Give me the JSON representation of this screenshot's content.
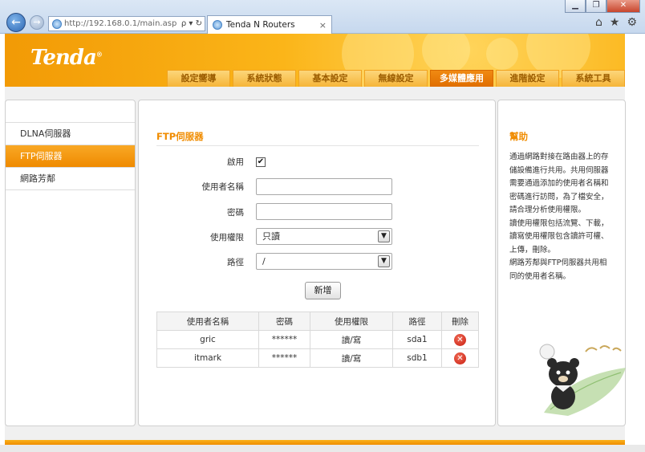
{
  "browser": {
    "url": "http://192.168.0.1/main.asp",
    "address_tools": "ρ ▾ ↻",
    "tab_title": "Tenda N Routers",
    "tab_close": "×",
    "back": "←",
    "forward": "→",
    "window_buttons": [
      "▁",
      "❐",
      "✕"
    ],
    "right_icons": [
      "⌂",
      "★",
      "⚙"
    ]
  },
  "router": {
    "logo": "Tenda",
    "logo_mark": "®",
    "main_tabs": [
      {
        "label": "設定嚮導",
        "active": false
      },
      {
        "label": "系統狀態",
        "active": false
      },
      {
        "label": "基本設定",
        "active": false
      },
      {
        "label": "無線設定",
        "active": false
      },
      {
        "label": "多媒體應用",
        "active": true
      },
      {
        "label": "進階設定",
        "active": false
      },
      {
        "label": "系統工具",
        "active": false
      }
    ],
    "sidebar": [
      {
        "label": "DLNA伺服器",
        "active": false
      },
      {
        "label": "FTP伺服器",
        "active": true
      },
      {
        "label": "網路芳鄰",
        "active": false
      }
    ]
  },
  "ftp": {
    "title": "FTP伺服器",
    "enable_label": "啟用",
    "enable_checked": "✔",
    "username_label": "使用者名稱",
    "username_value": "",
    "password_label": "密碼",
    "password_value": "",
    "permission_label": "使用權限",
    "permission_value": "只讀",
    "path_label": "路徑",
    "path_value": "/",
    "select_arrow": "▼",
    "add_button": "新增",
    "table": {
      "headers": [
        "使用者名稱",
        "密碼",
        "使用權限",
        "路徑",
        "刪除"
      ],
      "rows": [
        {
          "user": "gric",
          "password": "******",
          "permission": "讀/寫",
          "path": "sda1",
          "delete": "✕"
        },
        {
          "user": "itmark",
          "password": "******",
          "permission": "讀/寫",
          "path": "sdb1",
          "delete": "✕"
        }
      ]
    }
  },
  "help": {
    "title": "幫助",
    "lines": [
      "通過網路對接在路由器上的存",
      "儲設備進行共用。共用伺服器",
      "需要通過添加的使用者名稱和",
      "密碼進行訪問，為了檔安全，",
      "請合理分析使用權限。",
      "讀使用權限包括流覽、下載，",
      "讀寫使用權限包含讀許可權、",
      "上傳，刪除。",
      "網路芳鄰與FTP伺服器共用相",
      "同的使用者名稱。"
    ]
  },
  "colors": {
    "accent": "#f08c00",
    "header_orange": "#fbb519",
    "active_tab": "#e06e00"
  }
}
